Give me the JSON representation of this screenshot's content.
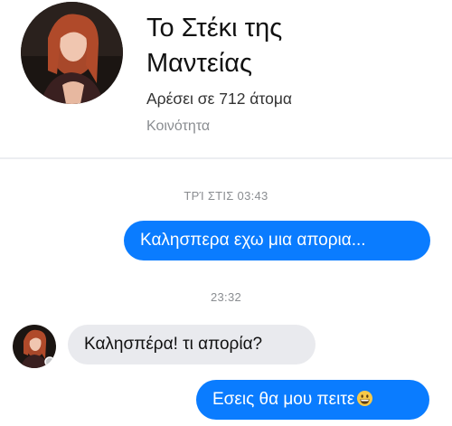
{
  "page": {
    "name": "Το Στέκι της\nΜαντείας",
    "likes": "Αρέσει σε 712 άτομα",
    "category": "Κοινότητα"
  },
  "conversation": {
    "timestamps": [
      "ΤΡΊ ΣΤΙΣ 03:43",
      "23:32"
    ],
    "messages": [
      {
        "sender": "me",
        "text": "Καλησπερα εχω μια απορια..."
      },
      {
        "sender": "page",
        "text": "Καλησπέρα! τι απορία?"
      },
      {
        "sender": "me",
        "text": "Εσεις θα μου πειτε",
        "emoji": "grinning-face-icon"
      }
    ]
  },
  "colors": {
    "outgoing_bubble": "#0a7cff",
    "incoming_bubble": "#e9eaee",
    "timestamp": "#8a8d91"
  }
}
